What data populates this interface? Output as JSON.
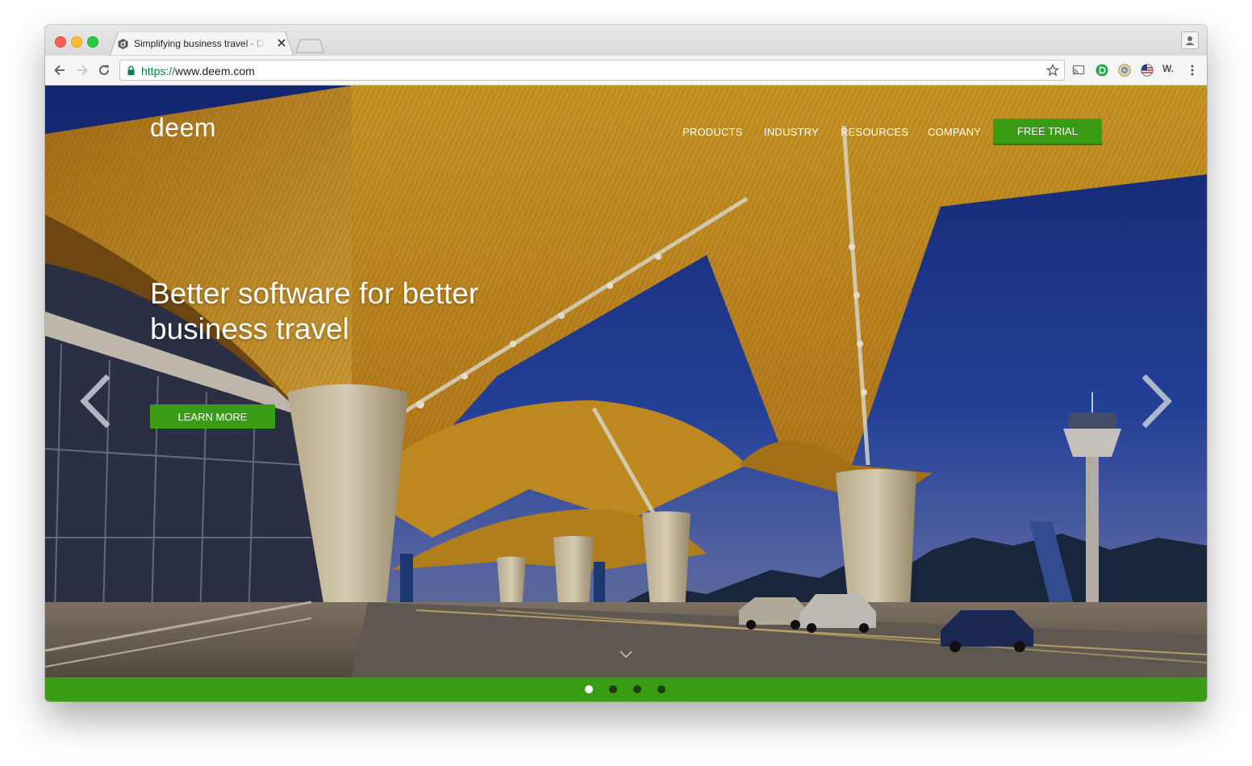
{
  "browser": {
    "tab_title": "Simplifying business travel - Deem",
    "url_scheme": "https://",
    "url_host": "www.deem.com"
  },
  "site": {
    "logo_text": "deem",
    "logo_mark": "·",
    "nav": {
      "products": "PRODUCTS",
      "industry": "INDUSTRY",
      "resources": "RESOURCES",
      "company": "COMPANY",
      "free_trial": "FREE TRIAL"
    },
    "hero": {
      "headline": "Better software for better business travel",
      "cta": "LEARN MORE"
    },
    "carousel": {
      "slide_count": 4,
      "active_slide": 1
    }
  },
  "colors": {
    "brand_green": "#3a9c14",
    "sky": "#1b2f75",
    "canopy": "#d89a1c"
  }
}
